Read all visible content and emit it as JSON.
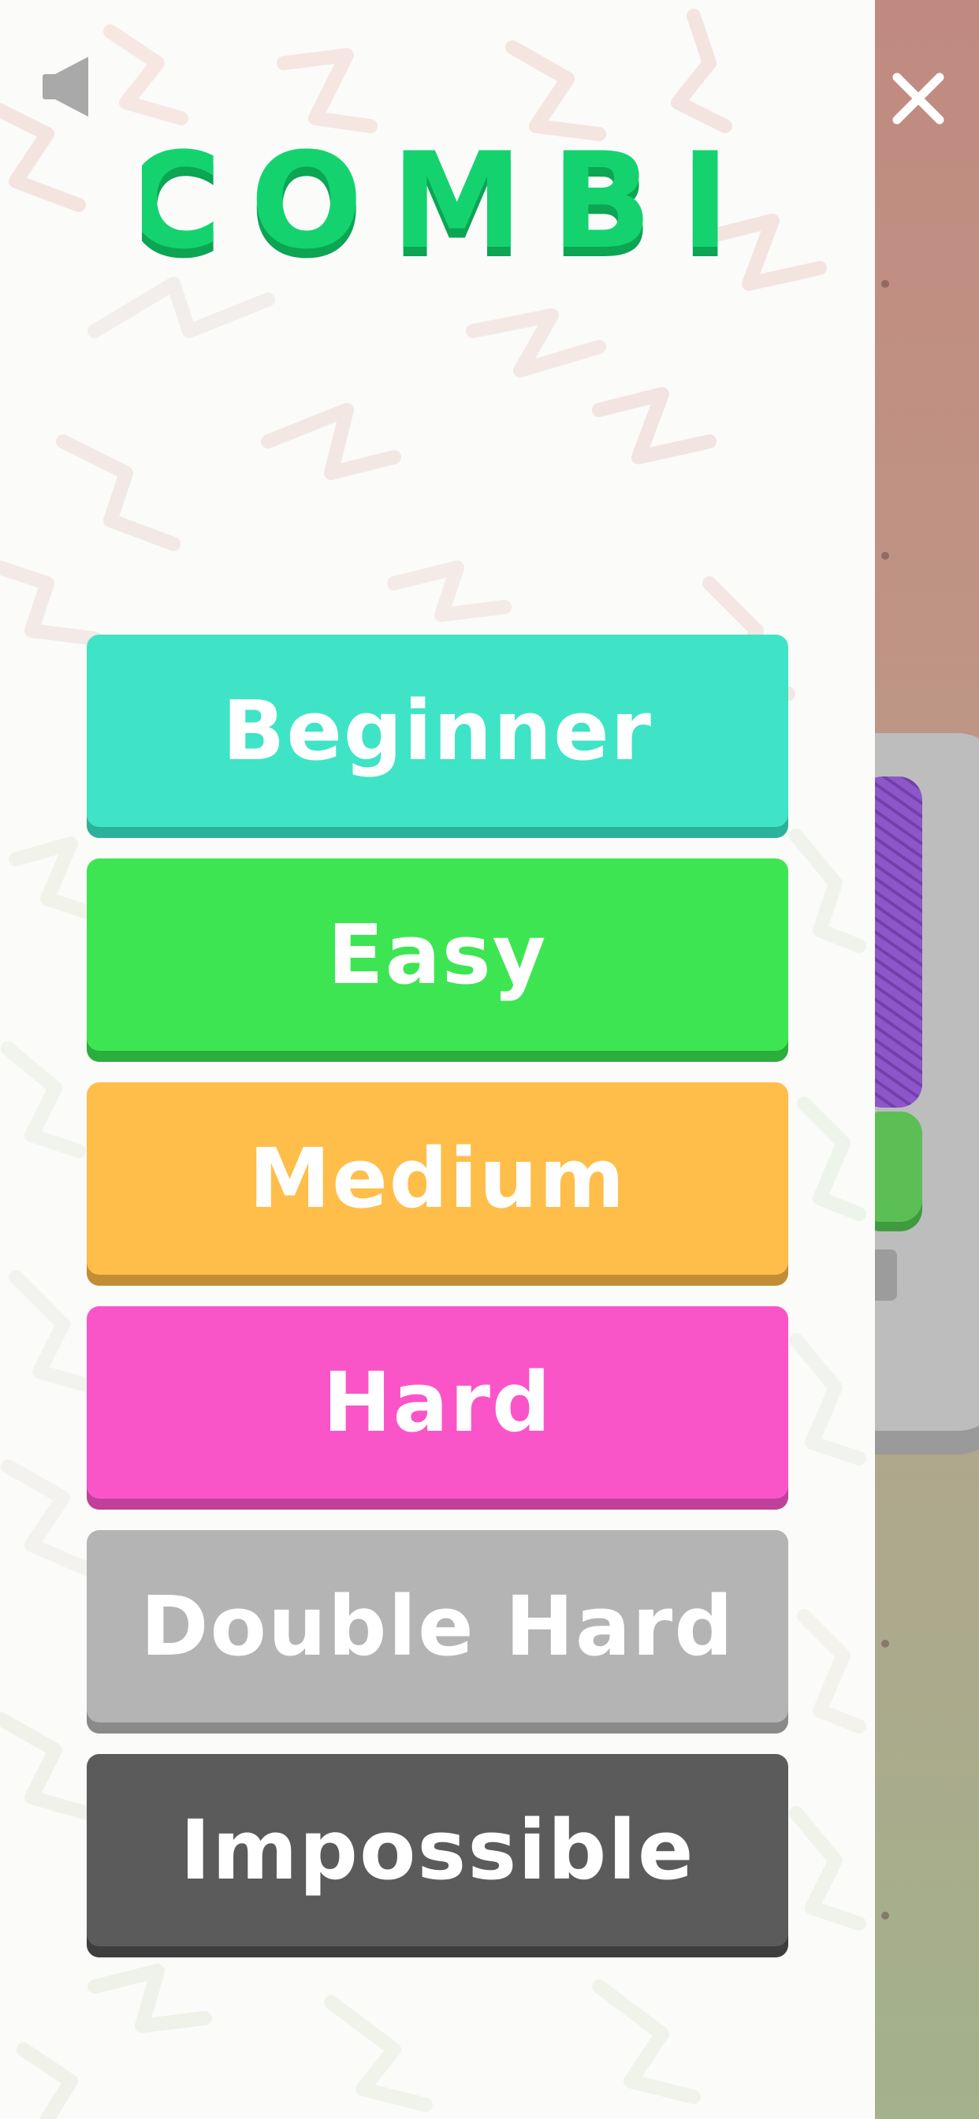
{
  "title": "COMBI",
  "controls": {
    "sound_icon": "speaker-icon",
    "close_icon": "close-icon"
  },
  "levels": [
    {
      "label": "Beginner",
      "color": "#3EE4C5"
    },
    {
      "label": "Easy",
      "color": "#3EE552"
    },
    {
      "label": "Medium",
      "color": "#FFBE49"
    },
    {
      "label": "Hard",
      "color": "#FA55C8"
    },
    {
      "label": "Double Hard",
      "color": "#B4B4B4"
    },
    {
      "label": "Impossible",
      "color": "#5B5B5B"
    }
  ],
  "colors": {
    "logo": "#14D36F",
    "logo_shadow": "#0BA553",
    "panel": "#FBFBFA"
  }
}
